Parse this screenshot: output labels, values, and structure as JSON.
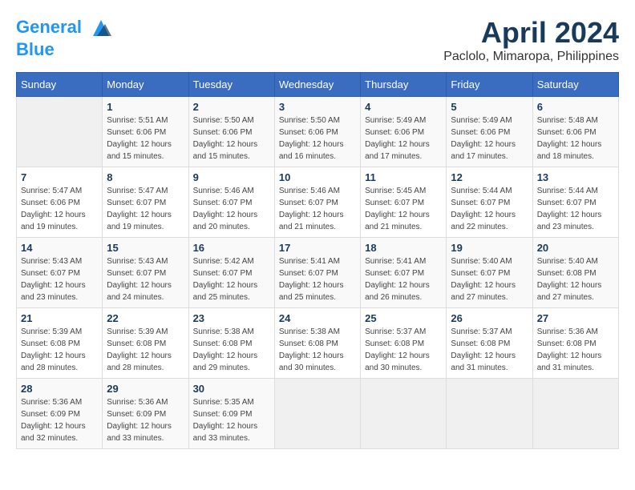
{
  "header": {
    "logo_line1": "General",
    "logo_line2": "Blue",
    "month": "April 2024",
    "location": "Paclolo, Mimaropa, Philippines"
  },
  "weekdays": [
    "Sunday",
    "Monday",
    "Tuesday",
    "Wednesday",
    "Thursday",
    "Friday",
    "Saturday"
  ],
  "weeks": [
    [
      {
        "day": "",
        "info": ""
      },
      {
        "day": "1",
        "info": "Sunrise: 5:51 AM\nSunset: 6:06 PM\nDaylight: 12 hours\nand 15 minutes."
      },
      {
        "day": "2",
        "info": "Sunrise: 5:50 AM\nSunset: 6:06 PM\nDaylight: 12 hours\nand 15 minutes."
      },
      {
        "day": "3",
        "info": "Sunrise: 5:50 AM\nSunset: 6:06 PM\nDaylight: 12 hours\nand 16 minutes."
      },
      {
        "day": "4",
        "info": "Sunrise: 5:49 AM\nSunset: 6:06 PM\nDaylight: 12 hours\nand 17 minutes."
      },
      {
        "day": "5",
        "info": "Sunrise: 5:49 AM\nSunset: 6:06 PM\nDaylight: 12 hours\nand 17 minutes."
      },
      {
        "day": "6",
        "info": "Sunrise: 5:48 AM\nSunset: 6:06 PM\nDaylight: 12 hours\nand 18 minutes."
      }
    ],
    [
      {
        "day": "7",
        "info": "Sunrise: 5:47 AM\nSunset: 6:06 PM\nDaylight: 12 hours\nand 19 minutes."
      },
      {
        "day": "8",
        "info": "Sunrise: 5:47 AM\nSunset: 6:07 PM\nDaylight: 12 hours\nand 19 minutes."
      },
      {
        "day": "9",
        "info": "Sunrise: 5:46 AM\nSunset: 6:07 PM\nDaylight: 12 hours\nand 20 minutes."
      },
      {
        "day": "10",
        "info": "Sunrise: 5:46 AM\nSunset: 6:07 PM\nDaylight: 12 hours\nand 21 minutes."
      },
      {
        "day": "11",
        "info": "Sunrise: 5:45 AM\nSunset: 6:07 PM\nDaylight: 12 hours\nand 21 minutes."
      },
      {
        "day": "12",
        "info": "Sunrise: 5:44 AM\nSunset: 6:07 PM\nDaylight: 12 hours\nand 22 minutes."
      },
      {
        "day": "13",
        "info": "Sunrise: 5:44 AM\nSunset: 6:07 PM\nDaylight: 12 hours\nand 23 minutes."
      }
    ],
    [
      {
        "day": "14",
        "info": "Sunrise: 5:43 AM\nSunset: 6:07 PM\nDaylight: 12 hours\nand 23 minutes."
      },
      {
        "day": "15",
        "info": "Sunrise: 5:43 AM\nSunset: 6:07 PM\nDaylight: 12 hours\nand 24 minutes."
      },
      {
        "day": "16",
        "info": "Sunrise: 5:42 AM\nSunset: 6:07 PM\nDaylight: 12 hours\nand 25 minutes."
      },
      {
        "day": "17",
        "info": "Sunrise: 5:41 AM\nSunset: 6:07 PM\nDaylight: 12 hours\nand 25 minutes."
      },
      {
        "day": "18",
        "info": "Sunrise: 5:41 AM\nSunset: 6:07 PM\nDaylight: 12 hours\nand 26 minutes."
      },
      {
        "day": "19",
        "info": "Sunrise: 5:40 AM\nSunset: 6:07 PM\nDaylight: 12 hours\nand 27 minutes."
      },
      {
        "day": "20",
        "info": "Sunrise: 5:40 AM\nSunset: 6:08 PM\nDaylight: 12 hours\nand 27 minutes."
      }
    ],
    [
      {
        "day": "21",
        "info": "Sunrise: 5:39 AM\nSunset: 6:08 PM\nDaylight: 12 hours\nand 28 minutes."
      },
      {
        "day": "22",
        "info": "Sunrise: 5:39 AM\nSunset: 6:08 PM\nDaylight: 12 hours\nand 28 minutes."
      },
      {
        "day": "23",
        "info": "Sunrise: 5:38 AM\nSunset: 6:08 PM\nDaylight: 12 hours\nand 29 minutes."
      },
      {
        "day": "24",
        "info": "Sunrise: 5:38 AM\nSunset: 6:08 PM\nDaylight: 12 hours\nand 30 minutes."
      },
      {
        "day": "25",
        "info": "Sunrise: 5:37 AM\nSunset: 6:08 PM\nDaylight: 12 hours\nand 30 minutes."
      },
      {
        "day": "26",
        "info": "Sunrise: 5:37 AM\nSunset: 6:08 PM\nDaylight: 12 hours\nand 31 minutes."
      },
      {
        "day": "27",
        "info": "Sunrise: 5:36 AM\nSunset: 6:08 PM\nDaylight: 12 hours\nand 31 minutes."
      }
    ],
    [
      {
        "day": "28",
        "info": "Sunrise: 5:36 AM\nSunset: 6:09 PM\nDaylight: 12 hours\nand 32 minutes."
      },
      {
        "day": "29",
        "info": "Sunrise: 5:36 AM\nSunset: 6:09 PM\nDaylight: 12 hours\nand 33 minutes."
      },
      {
        "day": "30",
        "info": "Sunrise: 5:35 AM\nSunset: 6:09 PM\nDaylight: 12 hours\nand 33 minutes."
      },
      {
        "day": "",
        "info": ""
      },
      {
        "day": "",
        "info": ""
      },
      {
        "day": "",
        "info": ""
      },
      {
        "day": "",
        "info": ""
      }
    ]
  ]
}
